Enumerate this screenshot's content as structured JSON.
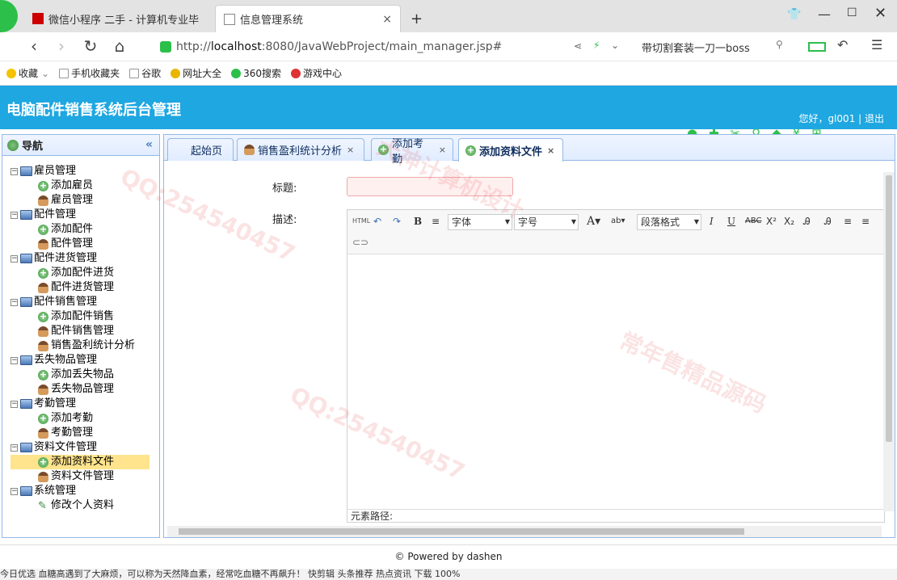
{
  "browser": {
    "tabs": [
      {
        "label": "微信小程序 二手 - 计算机专业毕"
      },
      {
        "label": "信息管理系统"
      }
    ],
    "new_tab": "+",
    "url_prefix": "http://",
    "url_host": "localhost",
    "url_rest": ":8080/JavaWebProject/main_manager.jsp#",
    "search_text": "带切割套装一刀一boss",
    "bookmarks": [
      "收藏",
      "手机收藏夹",
      "谷歌",
      "网址大全",
      "360搜索",
      "游戏中心"
    ]
  },
  "app": {
    "title": "电脑配件销售系统后台管理",
    "greeting": "您好，gl001 | 退出"
  },
  "nav": {
    "header": "导航",
    "collapse": "«",
    "groups": [
      {
        "label": "雇员管理",
        "items": [
          "添加雇员",
          "雇员管理"
        ]
      },
      {
        "label": "配件管理",
        "items": [
          "添加配件",
          "配件管理"
        ]
      },
      {
        "label": "配件进货管理",
        "items": [
          "添加配件进货",
          "配件进货管理"
        ]
      },
      {
        "label": "配件销售管理",
        "items": [
          "添加配件销售",
          "配件销售管理",
          "销售盈利统计分析"
        ]
      },
      {
        "label": "丢失物品管理",
        "items": [
          "添加丢失物品",
          "丢失物品管理"
        ]
      },
      {
        "label": "考勤管理",
        "items": [
          "添加考勤",
          "考勤管理"
        ]
      },
      {
        "label": "资料文件管理",
        "items": [
          "添加资料文件",
          "资料文件管理"
        ]
      },
      {
        "label": "系统管理",
        "items": [
          "修改个人资料"
        ]
      }
    ],
    "selected": "添加资料文件"
  },
  "content_tabs": [
    {
      "label": "起始页",
      "closable": false
    },
    {
      "label": "销售盈利统计分析",
      "closable": true
    },
    {
      "label": "添加考勤",
      "closable": true
    },
    {
      "label": "添加资料文件",
      "closable": true
    }
  ],
  "form": {
    "title_label": "标题:",
    "desc_label": "描述:",
    "title_value": ""
  },
  "editor": {
    "html_btn": "HTML",
    "font_family": "字体",
    "font_size": "字号",
    "paragraph": "段落格式",
    "path_label": "元素路径:"
  },
  "footer": {
    "text": "© Powered by dashen"
  },
  "status": {
    "text": "今日优选    血糖高遇到了大麻烦，可以称为天然降血素，经常吃血糖不再飙升！    快剪辑    头条推荐    热点资讯    下载    100%"
  },
  "watermarks": [
    "QQ:254540457",
    "大神计算机设计",
    "常年售精品源码"
  ]
}
